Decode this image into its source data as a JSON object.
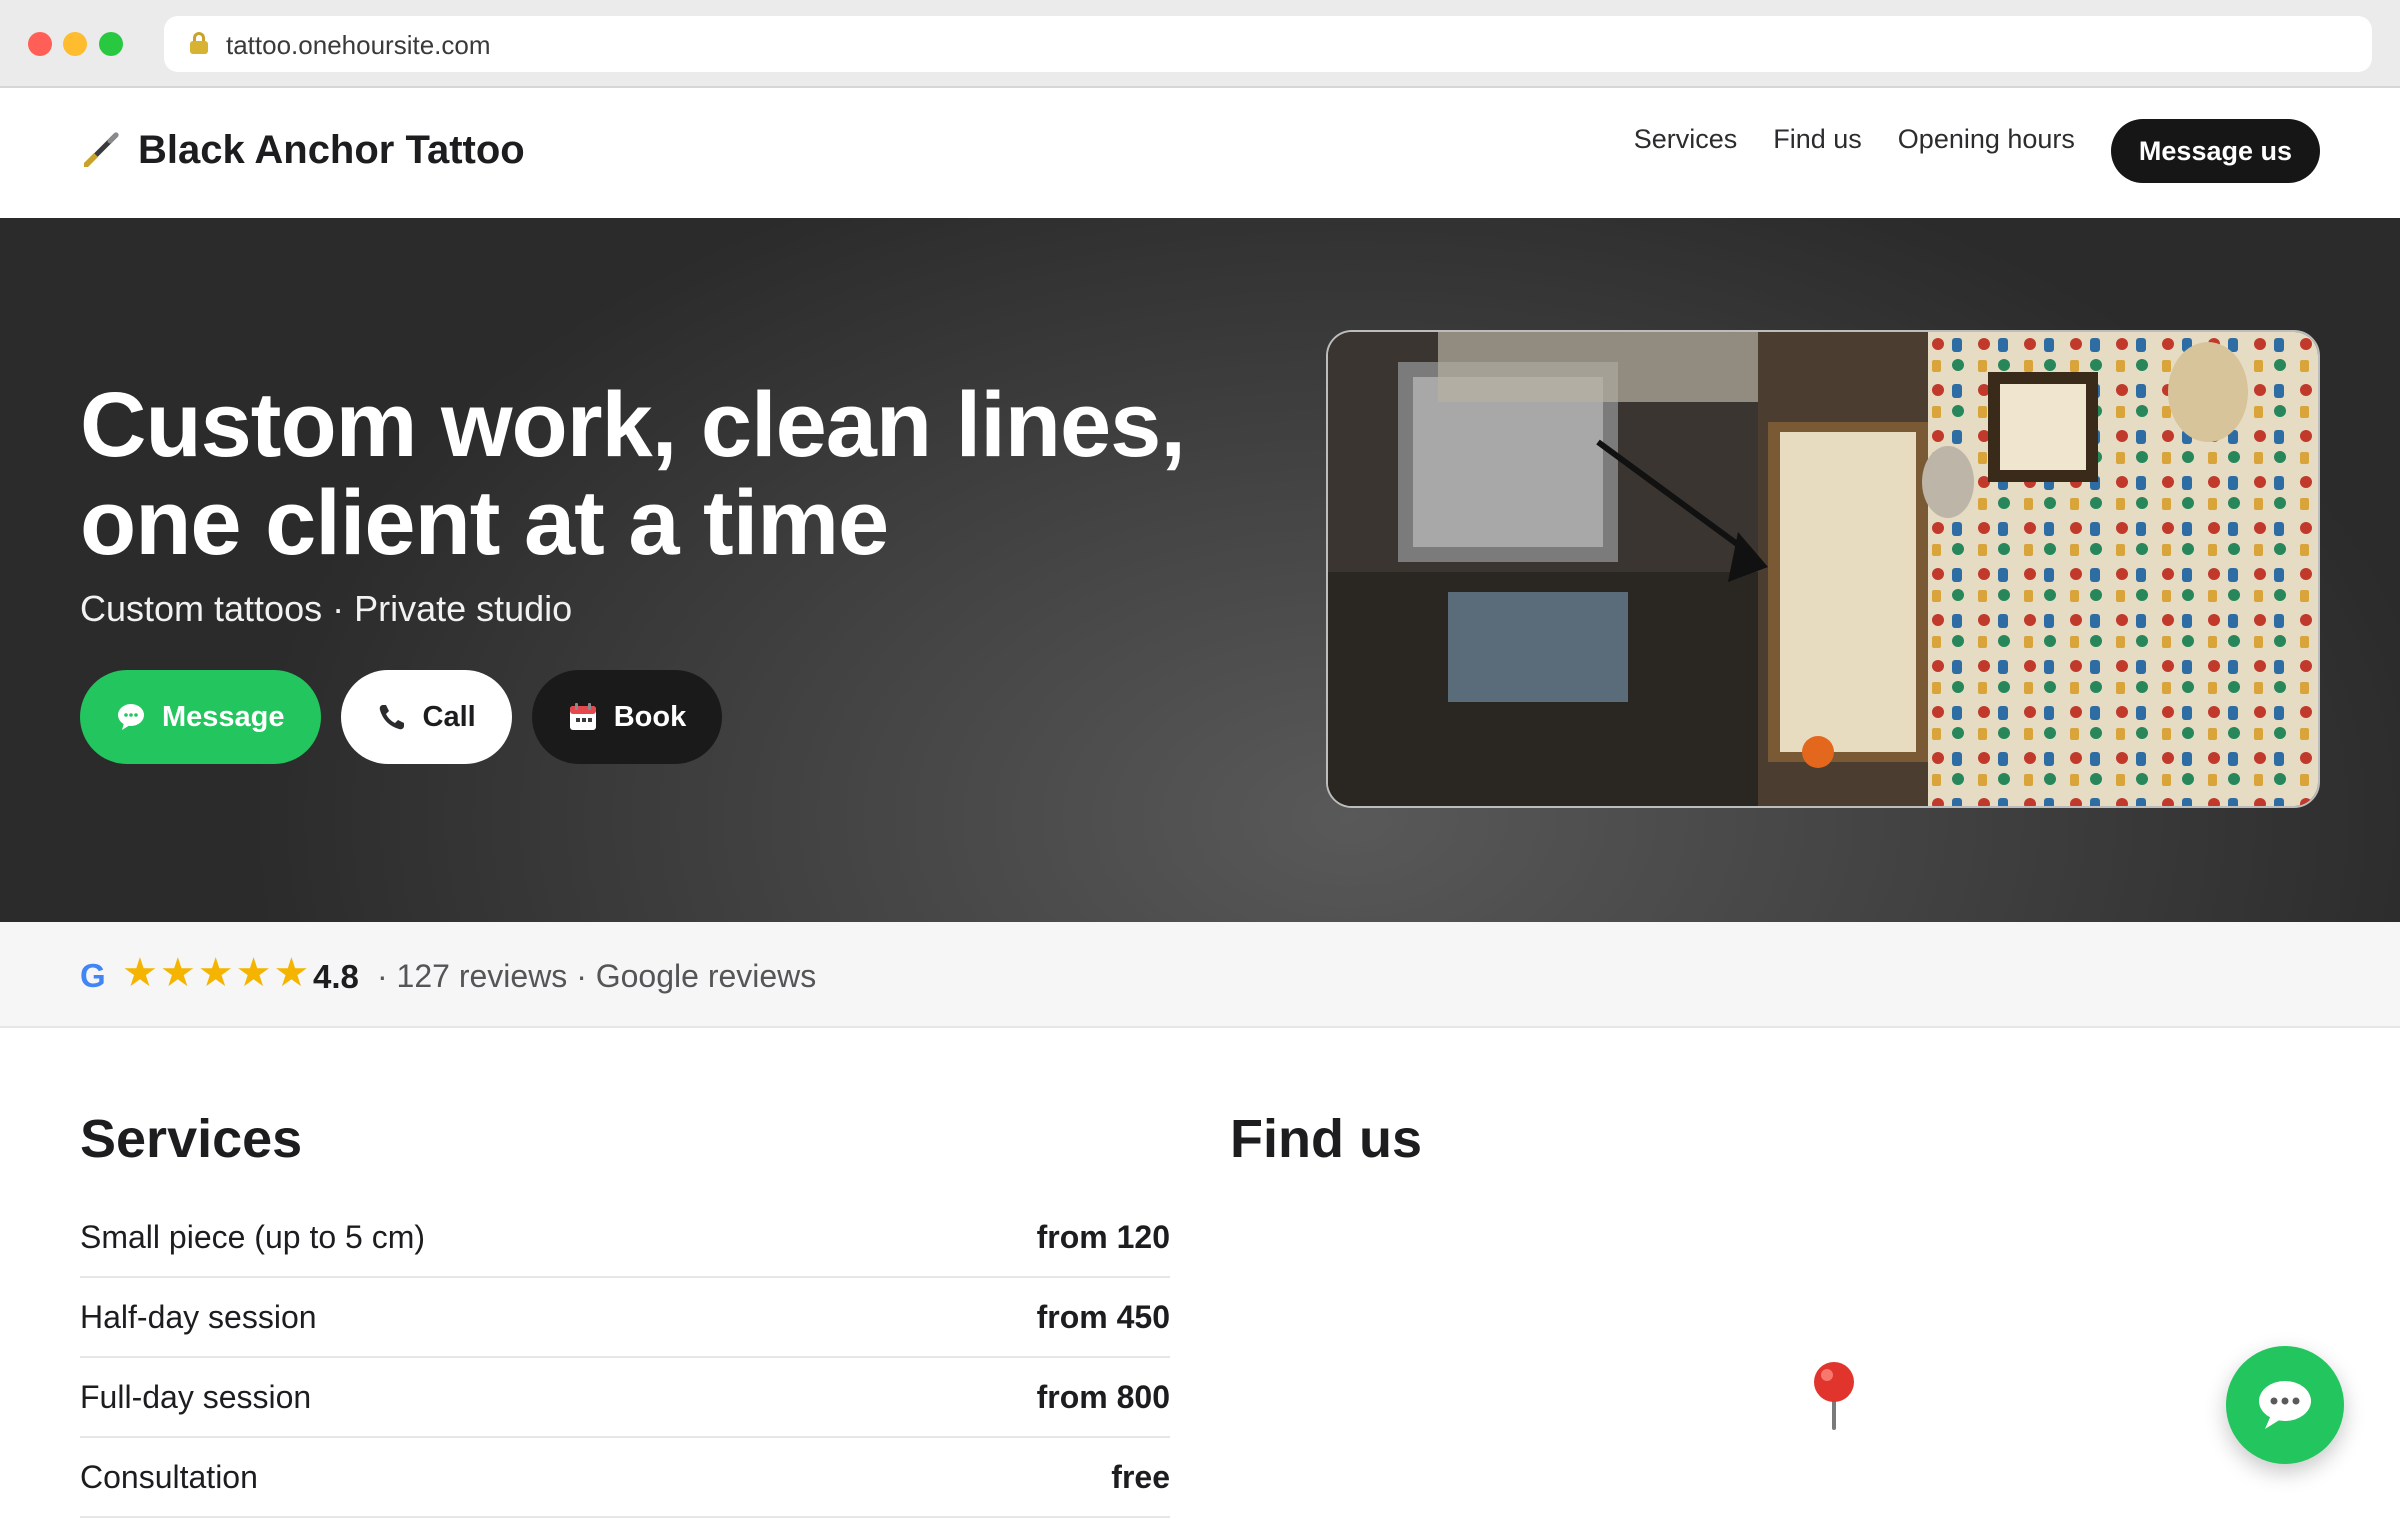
{
  "browser": {
    "url": "tattoo.onehoursite.com"
  },
  "header": {
    "brand": "Black Anchor Tattoo",
    "nav": [
      "Services",
      "Find us",
      "Opening hours"
    ],
    "cta": "Message us"
  },
  "hero": {
    "title_line1": "Custom work, clean lines,",
    "title_line2": "one client at a time",
    "subtitle": "Custom tattoos · Private studio",
    "buttons": {
      "message": "Message",
      "call": "Call",
      "book": "Book"
    },
    "photo_icon": "tattoo-studio-photo"
  },
  "reviews": {
    "source_logo": "G",
    "stars": "★★★★★",
    "rating": "4.8",
    "summary": "· 127 reviews · Google reviews"
  },
  "services": {
    "title": "Services",
    "items": [
      {
        "name": "Small piece (up to 5 cm)",
        "price": "from 120"
      },
      {
        "name": "Half-day session",
        "price": "from 450"
      },
      {
        "name": "Full-day session",
        "price": "from 800"
      },
      {
        "name": "Consultation",
        "price": "free"
      }
    ]
  },
  "find_us": {
    "title": "Find us",
    "map_icon": "map-pin-icon"
  },
  "chat": {
    "icon": "chat-bubble-icon"
  },
  "colors": {
    "accent_green": "#22c55e",
    "dark": "#161616",
    "star_gold": "#f4b400",
    "google_blue": "#4285f4"
  }
}
